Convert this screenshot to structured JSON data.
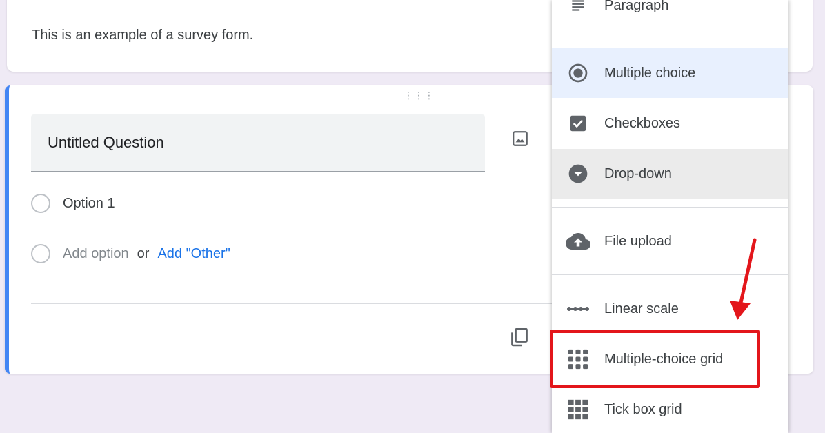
{
  "form": {
    "description": "This is an example of a survey form."
  },
  "question": {
    "title": "Untitled Question",
    "option1": "Option 1",
    "add_option": "Add option",
    "or": "or",
    "add_other": "Add \"Other\""
  },
  "menu": {
    "items": [
      {
        "label": "Paragraph",
        "icon": "paragraph-icon"
      },
      {
        "label": "Multiple choice",
        "icon": "radio-selected-icon",
        "selected": true
      },
      {
        "label": "Checkboxes",
        "icon": "checkbox-icon"
      },
      {
        "label": "Drop-down",
        "icon": "dropdown-circle-icon",
        "hovered": true
      },
      {
        "label": "File upload",
        "icon": "cloud-upload-icon"
      },
      {
        "label": "Linear scale",
        "icon": "linear-scale-icon"
      },
      {
        "label": "Multiple-choice grid",
        "icon": "grid-icon",
        "highlighted": true
      },
      {
        "label": "Tick box grid",
        "icon": "grid-icon"
      }
    ]
  },
  "colors": {
    "accent": "#4285f4",
    "link": "#1a73e8",
    "annotation": "#e3161b",
    "selected_bg": "#e8f0fe",
    "background": "#efeaf5"
  }
}
